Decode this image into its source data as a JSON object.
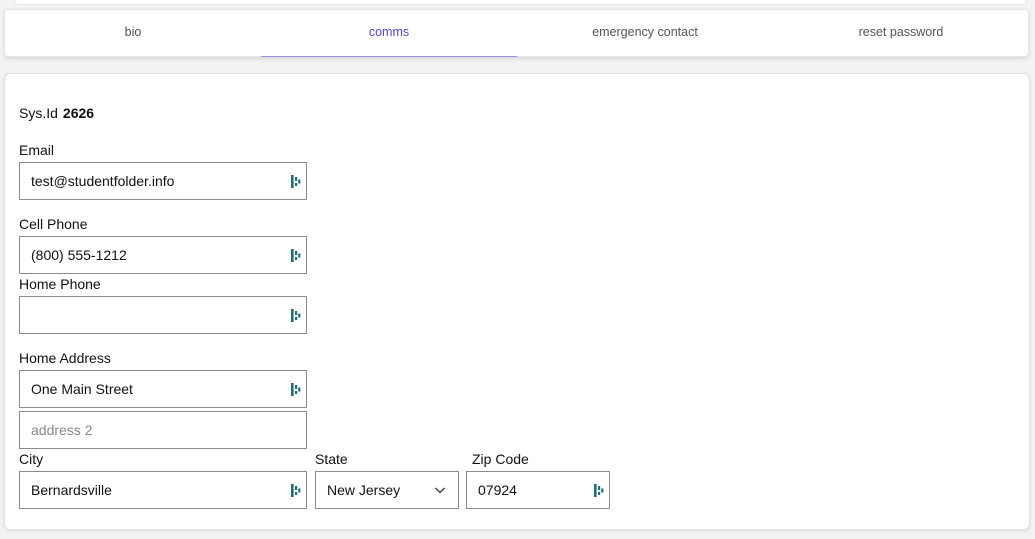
{
  "tabs": [
    {
      "label": "bio"
    },
    {
      "label": "comms"
    },
    {
      "label": "emergency contact"
    },
    {
      "label": "reset password"
    }
  ],
  "active_tab": "comms",
  "sys": {
    "label": "Sys.Id",
    "value": "2626"
  },
  "email": {
    "label": "Email",
    "value": "test@studentfolder.info"
  },
  "cell_phone": {
    "label": "Cell Phone",
    "value": "(800) 555-1212"
  },
  "home_phone": {
    "label": "Home Phone",
    "value": ""
  },
  "home_address": {
    "label": "Home Address",
    "line1": "One Main Street",
    "line2_placeholder": "address 2"
  },
  "city": {
    "label": "City",
    "value": "Bernardsville"
  },
  "state": {
    "label": "State",
    "value": "New Jersey"
  },
  "zip": {
    "label": "Zip Code",
    "value": "07924"
  },
  "colors": {
    "accent": "#5b3fc7",
    "icon": "#1f6f6f"
  },
  "icons": {
    "field_icon": "password-manager-icon",
    "dropdown": "chevron-down-icon"
  }
}
